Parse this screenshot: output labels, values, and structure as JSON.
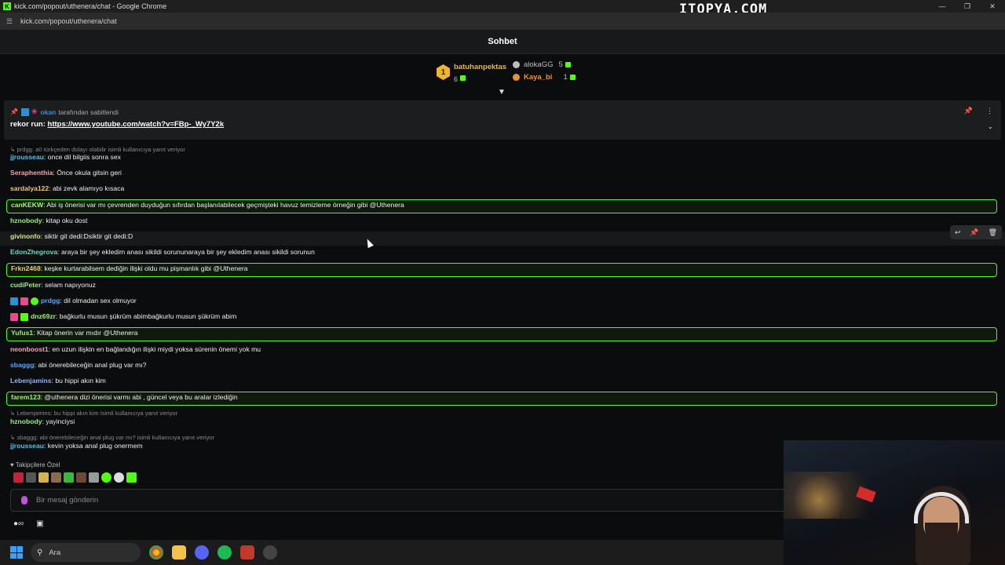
{
  "window": {
    "title": "kick.com/popout/uthenera/chat - Google Chrome",
    "url": "kick.com/popout/uthenera/chat",
    "watermark": "ITOPYA.COM"
  },
  "chat_header": {
    "title": "Sohbet"
  },
  "leaderboard": {
    "first": {
      "rank": "1",
      "name": "batuhanpektas",
      "count": "6"
    },
    "others": [
      {
        "name": "alokaGG",
        "count": "5",
        "color": "#bdbdbd"
      },
      {
        "name": "Kaya_bi",
        "count": "1",
        "color": "#e8922e"
      }
    ]
  },
  "pinned": {
    "pinned_by": "okan",
    "pinned_by_suffix": "tarafından sabitlendi",
    "message_prefix": "rekor run:",
    "link": "https://www.youtube.com/watch?v=FBp-_Wy7Y2k"
  },
  "messages": [
    {
      "reply": "prdgg: a0 türkçeden dolayı olabilir  isimli kullanıcıya yanıt veriyor",
      "user": "jjrousseau",
      "color": "#53c1e8",
      "text": "once dil bilgiis sonra sex"
    },
    {
      "user": "Seraphenthia",
      "color": "#f2a3b3",
      "text": "Önce okula gitsin geri"
    },
    {
      "user": "sardalya122",
      "color": "#f0c674",
      "text": "abi zevk alamıyo kısaca"
    },
    {
      "user": "canKEKW",
      "color": "#b0f27a",
      "text": "Abi iş önerisi var mı çevrenden duyduğun sıfırdan başlanılabilecek geçmişteki havuz temizleme örneğin gibi @Uthenera",
      "highlight": true
    },
    {
      "user": "hznobody",
      "color": "#9ef07a",
      "text": "kitap oku dost"
    },
    {
      "user": "givinonfo",
      "color": "#cfe88c",
      "text": "siktir git dedi:Dsiktir git dedi:D"
    },
    {
      "user": "EdonZhegrova",
      "color": "#5ce0c8",
      "text": "araya bir şey ekledim anası sikildi sorununaraya bir şey ekledim anası sikildi sorunun"
    },
    {
      "user": "Frkn2468",
      "color": "#f0c674",
      "text": "keşke kurtarabilsem dediğin ilişki oldu mu pişmanlık gibi @Uthenera",
      "highlight": true
    },
    {
      "user": "cudiPeter",
      "color": "#9ef07a",
      "text": "selam napıyonuz"
    },
    {
      "user": "prdgg",
      "color": "#5aa7ff",
      "text": "dil olmadan sex olmuyor",
      "badges": true
    },
    {
      "user": "dnz69zr",
      "color": "#9ef07a",
      "text": "bağkurlu musun şükrüm abimbağkurlu musun şükrüm abim",
      "badges2": true
    },
    {
      "user": "Yufus1",
      "color": "#9ef07a",
      "text": "Kitap önerin var mıdır @Uthenera",
      "highlight": true
    },
    {
      "user": "neonboost1",
      "color": "#f2a3b3",
      "text": "en uzun ilişkin en bağlandığın ilişki miydi yoksa sürenin önemi yok mu"
    },
    {
      "user": "sbaggg",
      "color": "#5aa7ff",
      "text": "abi önerebileceğin anal plug var mı?"
    },
    {
      "user": "Lebenjamins",
      "color": "#8fb4ff",
      "text": "bu hippi akın kim"
    },
    {
      "user": "farem123",
      "color": "#9ef07a",
      "text": "@uthenera dizi önerisi varmı abi , güncel veya bu aralar izlediğin",
      "highlight": true
    },
    {
      "reply": "Lebenjamins: bu hippi akın kim isimli kullanıcıya yanıt veriyor",
      "user": "hznobody",
      "color": "#9ef07a",
      "text": "yayinciysi"
    },
    {
      "reply": "sbaggg: abi önerebileceğin anal plug var mı? isimli kullanıcıya yanıt veriyor",
      "user": "jjrousseau",
      "color": "#53c1e8",
      "text": "kevin yoksa anal plug onermem"
    }
  ],
  "followers_label": "Takipçilere Özel",
  "composer": {
    "placeholder": "Bir mesaj gönderin"
  },
  "taskbar": {
    "search": "Ara"
  },
  "colors": {
    "accent": "#53fc18",
    "background": "#0b0c0d"
  }
}
